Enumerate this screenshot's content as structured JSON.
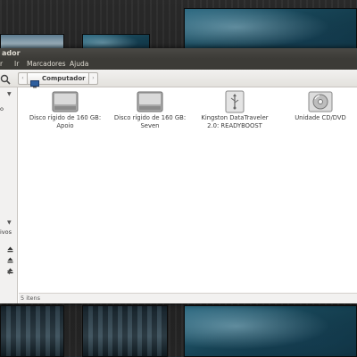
{
  "window": {
    "title": "ador"
  },
  "menubar": {
    "items": [
      "r",
      "Ir",
      "Marcadores",
      "Ajuda"
    ]
  },
  "toolbar": {
    "location_label": "Computador",
    "back_glyph": "‹",
    "forward_glyph": "›"
  },
  "sidebar": {
    "partial_text_1": "o",
    "partial_text_2": "ivos"
  },
  "devices": [
    {
      "label_line1": "Disco rígido de 160 GB:",
      "label_line2": "Apoio",
      "icon": "hard-drive-icon"
    },
    {
      "label_line1": "Disco rígido de 160 GB:",
      "label_line2": "Seven",
      "icon": "hard-drive-icon"
    },
    {
      "label_line1": "Kingston DataTraveler",
      "label_line2": "2.0: READYBOOST",
      "icon": "usb-drive-icon"
    },
    {
      "label_line1": "Unidade CD/DVD",
      "label_line2": "",
      "icon": "optical-drive-icon"
    }
  ],
  "status": {
    "text": "5 itens"
  },
  "colors": {
    "titlebar": "#3c3b37",
    "menu_text": "#dfdbd2",
    "window_bg": "#ffffff",
    "sidebar_bg": "#f2f1f0"
  }
}
